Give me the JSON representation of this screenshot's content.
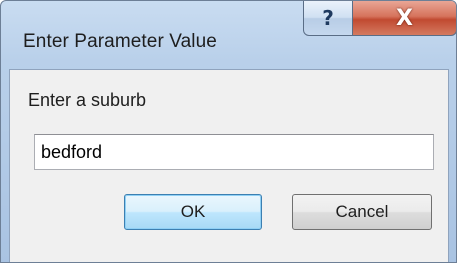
{
  "window": {
    "title": "Enter Parameter Value",
    "help_glyph": "?",
    "close_glyph": "X"
  },
  "prompt": {
    "label": "Enter a suburb",
    "value": "bedford"
  },
  "buttons": {
    "ok_label": "OK",
    "cancel_label": "Cancel"
  },
  "colors": {
    "title_gradient_top": "#c9dcf1",
    "close_button": "#c14a31",
    "ok_focus_border": "#3c7fb1"
  },
  "icons": {
    "help": "help-icon",
    "close": "close-icon"
  }
}
